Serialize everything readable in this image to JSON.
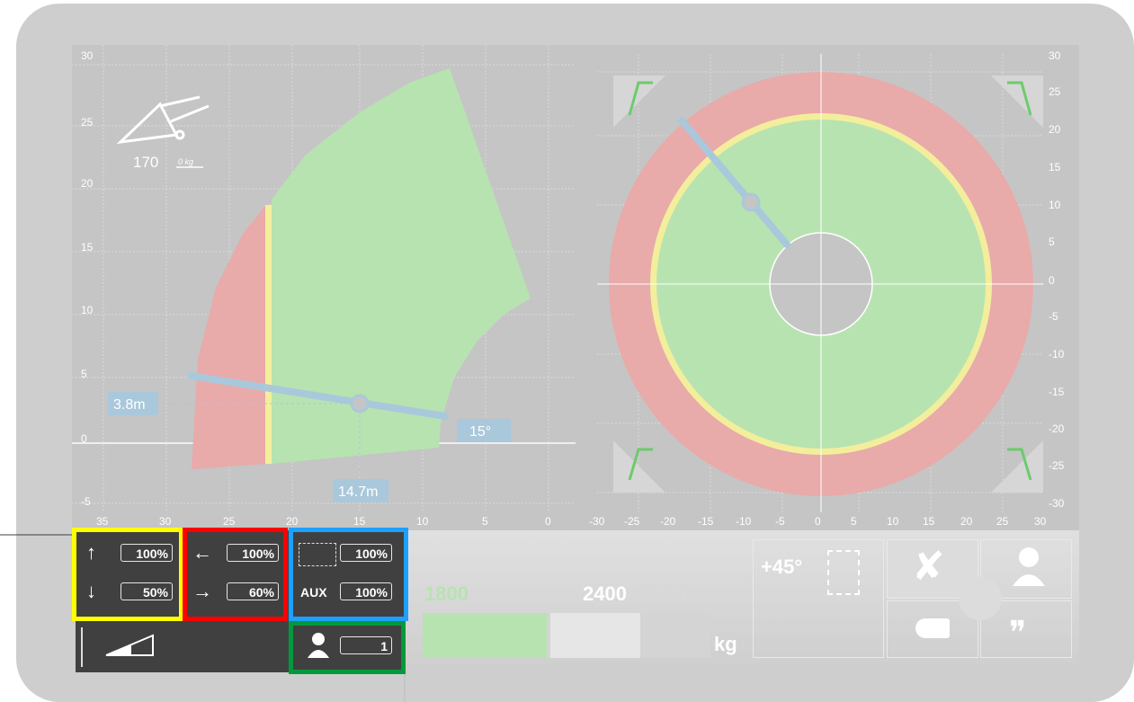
{
  "range_chart": {
    "y_ticks": [
      "30",
      "25",
      "20",
      "15",
      "10",
      "5",
      "0",
      "-5"
    ],
    "x_ticks": [
      "35",
      "30",
      "25",
      "20",
      "15",
      "10",
      "5",
      "0"
    ],
    "radius_label": "3.8m",
    "distance_label": "14.7m",
    "angle_label": "15°",
    "load_value": "170",
    "load_unit": "0 kg"
  },
  "slew_chart": {
    "x_ticks": [
      "-30",
      "-25",
      "-20",
      "-15",
      "-10",
      "-5",
      "0",
      "5",
      "10",
      "15",
      "20",
      "25",
      "30"
    ],
    "y_ticks": [
      "30",
      "25",
      "20",
      "15",
      "10",
      "5",
      "0",
      "-5",
      "-10",
      "-15",
      "-20",
      "-25",
      "-30"
    ]
  },
  "controls": {
    "boom_up": "100%",
    "boom_down": "50%",
    "slew_left": "100%",
    "slew_right": "60%",
    "tilt": "100%",
    "aux_label": "AUX",
    "aux": "100%",
    "operator_count": "1"
  },
  "load_bar": {
    "current": "1800",
    "limit": "2400",
    "max": "4000",
    "unit": "kg",
    "fill_fraction": 0.43
  },
  "right_panel": {
    "slew_angle": "+45°"
  },
  "colors": {
    "safe": "#b7e3b0",
    "warn": "#f3ee9c",
    "danger": "#e9aaaa",
    "boom": "#aac8dc",
    "highlight_yellow": "#ffff00",
    "highlight_red": "#ff0000",
    "highlight_blue": "#1ea0ff",
    "highlight_green": "#009a3c"
  }
}
